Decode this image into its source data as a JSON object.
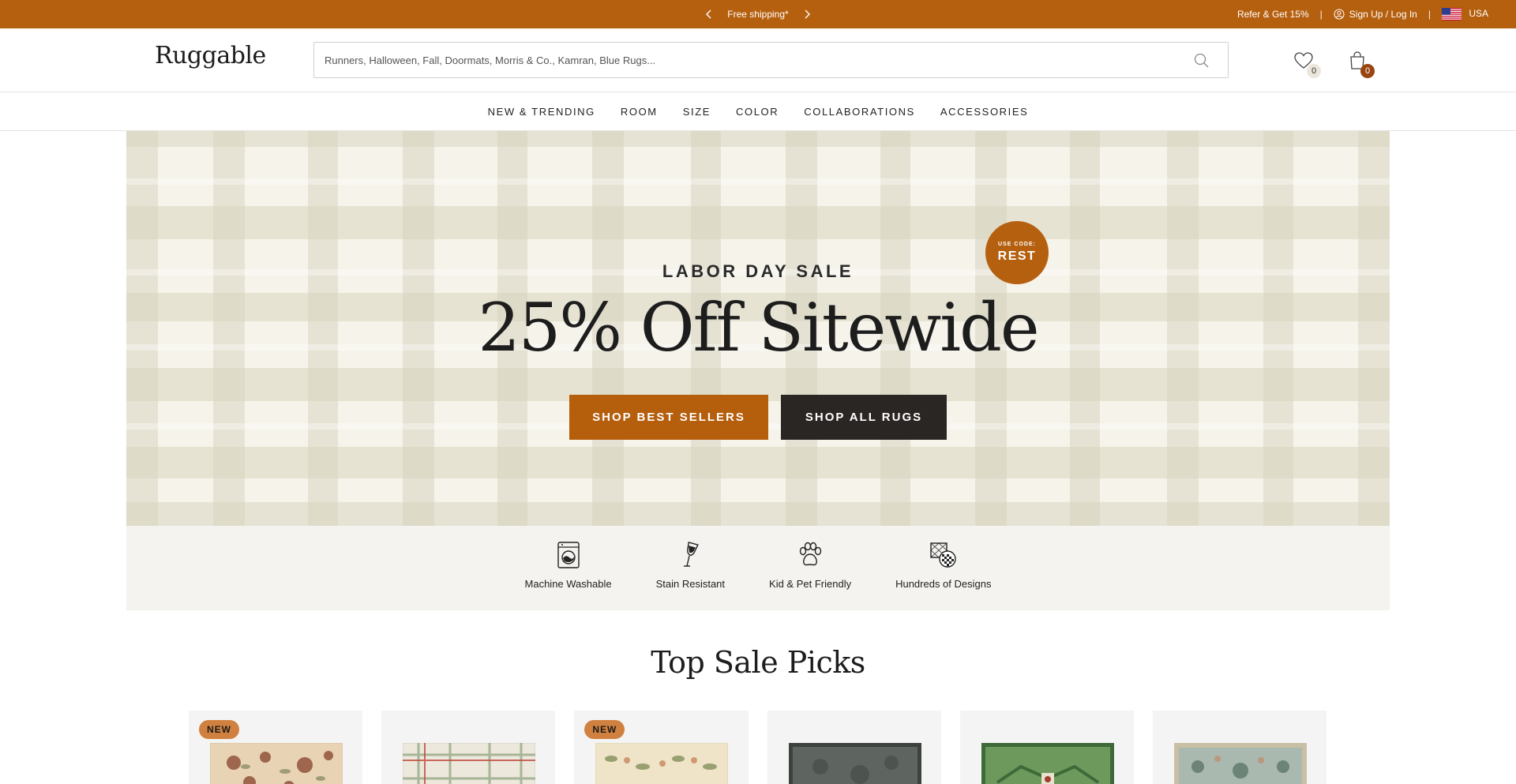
{
  "announcement": {
    "message": "Free shipping*",
    "refer": "Refer & Get 15%",
    "separator": "|",
    "account": "Sign Up / Log In",
    "country": "USA"
  },
  "header": {
    "logo": "Ruggable",
    "search_placeholder": "Runners, Halloween, Fall, Doormats, Morris & Co., Kamran, Blue Rugs...",
    "wishlist_count": "0",
    "cart_count": "0"
  },
  "nav": {
    "items": [
      "NEW & TRENDING",
      "ROOM",
      "SIZE",
      "COLOR",
      "COLLABORATIONS",
      "ACCESSORIES"
    ]
  },
  "hero": {
    "eyebrow": "LABOR DAY SALE",
    "headline": "25% Off Sitewide",
    "badge_top": "USE CODE:",
    "badge_code": "REST",
    "btn_primary": "SHOP BEST SELLERS",
    "btn_secondary": "SHOP ALL RUGS"
  },
  "features": [
    {
      "label": "Machine Washable",
      "icon": "washing-machine-icon"
    },
    {
      "label": "Stain Resistant",
      "icon": "wine-glass-icon"
    },
    {
      "label": "Kid & Pet Friendly",
      "icon": "paw-icon"
    },
    {
      "label": "Hundreds of Designs",
      "icon": "patterns-icon"
    }
  ],
  "section": {
    "title": "Top Sale Picks"
  },
  "products": [
    {
      "tag": "NEW",
      "colors": [
        "#e8d3b5",
        "#8c4b33"
      ]
    },
    {
      "tag": "",
      "colors": [
        "#ece8dc",
        "#8aa07a"
      ]
    },
    {
      "tag": "NEW",
      "colors": [
        "#efe4c7",
        "#7b8a55"
      ]
    },
    {
      "tag": "",
      "colors": [
        "#5e6460",
        "#3d423e"
      ]
    },
    {
      "tag": "",
      "colors": [
        "#6d9a5c",
        "#3e6a3a"
      ]
    },
    {
      "tag": "",
      "colors": [
        "#a9b9b0",
        "#5e7669"
      ]
    }
  ],
  "colors": {
    "accent": "#b5600f",
    "dark_button": "#2a2624",
    "new_tag": "#d1813f"
  }
}
